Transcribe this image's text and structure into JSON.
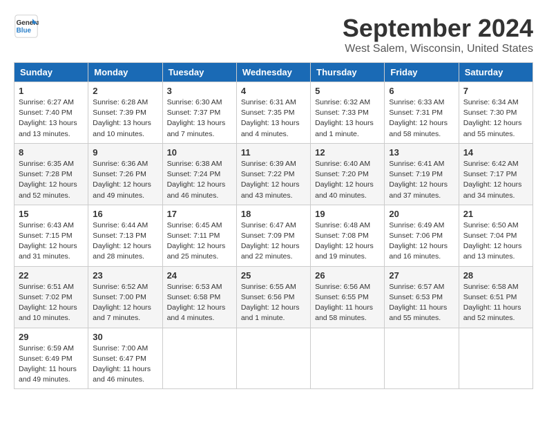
{
  "logo": {
    "general": "General",
    "blue": "Blue"
  },
  "title": "September 2024",
  "location": "West Salem, Wisconsin, United States",
  "days_of_week": [
    "Sunday",
    "Monday",
    "Tuesday",
    "Wednesday",
    "Thursday",
    "Friday",
    "Saturday"
  ],
  "weeks": [
    [
      {
        "day": "1",
        "info": "Sunrise: 6:27 AM\nSunset: 7:40 PM\nDaylight: 13 hours\nand 13 minutes."
      },
      {
        "day": "2",
        "info": "Sunrise: 6:28 AM\nSunset: 7:39 PM\nDaylight: 13 hours\nand 10 minutes."
      },
      {
        "day": "3",
        "info": "Sunrise: 6:30 AM\nSunset: 7:37 PM\nDaylight: 13 hours\nand 7 minutes."
      },
      {
        "day": "4",
        "info": "Sunrise: 6:31 AM\nSunset: 7:35 PM\nDaylight: 13 hours\nand 4 minutes."
      },
      {
        "day": "5",
        "info": "Sunrise: 6:32 AM\nSunset: 7:33 PM\nDaylight: 13 hours\nand 1 minute."
      },
      {
        "day": "6",
        "info": "Sunrise: 6:33 AM\nSunset: 7:31 PM\nDaylight: 12 hours\nand 58 minutes."
      },
      {
        "day": "7",
        "info": "Sunrise: 6:34 AM\nSunset: 7:30 PM\nDaylight: 12 hours\nand 55 minutes."
      }
    ],
    [
      {
        "day": "8",
        "info": "Sunrise: 6:35 AM\nSunset: 7:28 PM\nDaylight: 12 hours\nand 52 minutes."
      },
      {
        "day": "9",
        "info": "Sunrise: 6:36 AM\nSunset: 7:26 PM\nDaylight: 12 hours\nand 49 minutes."
      },
      {
        "day": "10",
        "info": "Sunrise: 6:38 AM\nSunset: 7:24 PM\nDaylight: 12 hours\nand 46 minutes."
      },
      {
        "day": "11",
        "info": "Sunrise: 6:39 AM\nSunset: 7:22 PM\nDaylight: 12 hours\nand 43 minutes."
      },
      {
        "day": "12",
        "info": "Sunrise: 6:40 AM\nSunset: 7:20 PM\nDaylight: 12 hours\nand 40 minutes."
      },
      {
        "day": "13",
        "info": "Sunrise: 6:41 AM\nSunset: 7:19 PM\nDaylight: 12 hours\nand 37 minutes."
      },
      {
        "day": "14",
        "info": "Sunrise: 6:42 AM\nSunset: 7:17 PM\nDaylight: 12 hours\nand 34 minutes."
      }
    ],
    [
      {
        "day": "15",
        "info": "Sunrise: 6:43 AM\nSunset: 7:15 PM\nDaylight: 12 hours\nand 31 minutes."
      },
      {
        "day": "16",
        "info": "Sunrise: 6:44 AM\nSunset: 7:13 PM\nDaylight: 12 hours\nand 28 minutes."
      },
      {
        "day": "17",
        "info": "Sunrise: 6:45 AM\nSunset: 7:11 PM\nDaylight: 12 hours\nand 25 minutes."
      },
      {
        "day": "18",
        "info": "Sunrise: 6:47 AM\nSunset: 7:09 PM\nDaylight: 12 hours\nand 22 minutes."
      },
      {
        "day": "19",
        "info": "Sunrise: 6:48 AM\nSunset: 7:08 PM\nDaylight: 12 hours\nand 19 minutes."
      },
      {
        "day": "20",
        "info": "Sunrise: 6:49 AM\nSunset: 7:06 PM\nDaylight: 12 hours\nand 16 minutes."
      },
      {
        "day": "21",
        "info": "Sunrise: 6:50 AM\nSunset: 7:04 PM\nDaylight: 12 hours\nand 13 minutes."
      }
    ],
    [
      {
        "day": "22",
        "info": "Sunrise: 6:51 AM\nSunset: 7:02 PM\nDaylight: 12 hours\nand 10 minutes."
      },
      {
        "day": "23",
        "info": "Sunrise: 6:52 AM\nSunset: 7:00 PM\nDaylight: 12 hours\nand 7 minutes."
      },
      {
        "day": "24",
        "info": "Sunrise: 6:53 AM\nSunset: 6:58 PM\nDaylight: 12 hours\nand 4 minutes."
      },
      {
        "day": "25",
        "info": "Sunrise: 6:55 AM\nSunset: 6:56 PM\nDaylight: 12 hours\nand 1 minute."
      },
      {
        "day": "26",
        "info": "Sunrise: 6:56 AM\nSunset: 6:55 PM\nDaylight: 11 hours\nand 58 minutes."
      },
      {
        "day": "27",
        "info": "Sunrise: 6:57 AM\nSunset: 6:53 PM\nDaylight: 11 hours\nand 55 minutes."
      },
      {
        "day": "28",
        "info": "Sunrise: 6:58 AM\nSunset: 6:51 PM\nDaylight: 11 hours\nand 52 minutes."
      }
    ],
    [
      {
        "day": "29",
        "info": "Sunrise: 6:59 AM\nSunset: 6:49 PM\nDaylight: 11 hours\nand 49 minutes."
      },
      {
        "day": "30",
        "info": "Sunrise: 7:00 AM\nSunset: 6:47 PM\nDaylight: 11 hours\nand 46 minutes."
      },
      {
        "day": "",
        "info": ""
      },
      {
        "day": "",
        "info": ""
      },
      {
        "day": "",
        "info": ""
      },
      {
        "day": "",
        "info": ""
      },
      {
        "day": "",
        "info": ""
      }
    ]
  ]
}
